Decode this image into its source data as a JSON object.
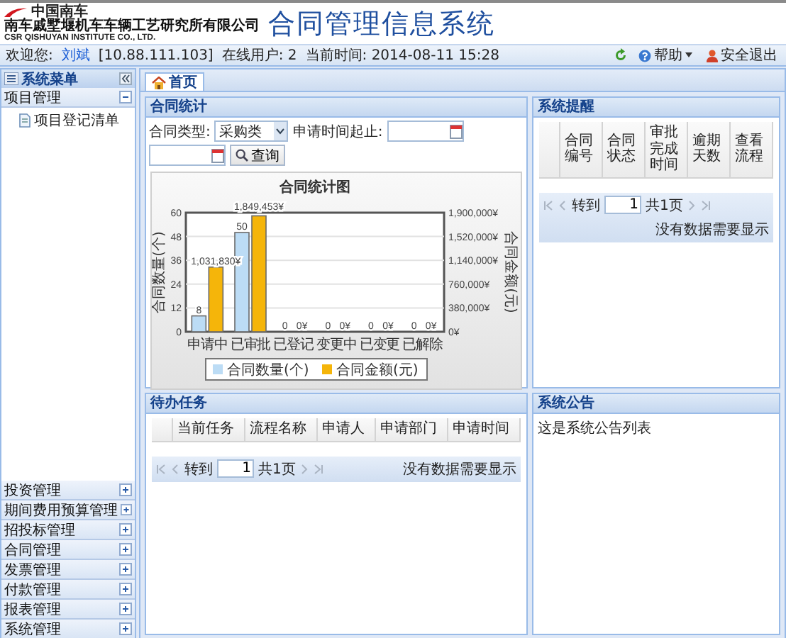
{
  "header": {
    "logo_text": "中国南车",
    "company": "南车戚墅堰机车车辆工艺研究所有限公司",
    "company_en": "CSR QISHUYAN INSTITUTE CO., LTD.",
    "system_title": "合同管理信息系统"
  },
  "status_bar": {
    "welcome_label": "欢迎您:",
    "user": "刘斌",
    "ip": "[10.88.111.103]",
    "online": "在线用户: 2",
    "time": "当前时间: 2014-08-11 15:28",
    "help": "帮助",
    "logout": "安全退出"
  },
  "sidebar": {
    "title": "系统菜单",
    "sections": [
      {
        "label": "项目管理",
        "expanded": true,
        "children": [
          {
            "label": "项目登记清单"
          }
        ]
      },
      {
        "label": "投资管理",
        "expanded": false
      },
      {
        "label": "期间费用预算管理",
        "expanded": false
      },
      {
        "label": "招投标管理",
        "expanded": false
      },
      {
        "label": "合同管理",
        "expanded": false
      },
      {
        "label": "发票管理",
        "expanded": false
      },
      {
        "label": "付款管理",
        "expanded": false
      },
      {
        "label": "报表管理",
        "expanded": false
      },
      {
        "label": "系统管理",
        "expanded": false
      }
    ]
  },
  "tabs": [
    {
      "label": "首页",
      "selected": true
    }
  ],
  "contract_stats": {
    "title": "合同统计",
    "type_label": "合同类型:",
    "type_value": "采购类",
    "date_label": "申请时间起止:",
    "query_button": "查询",
    "chart_data": {
      "type": "bar",
      "title": "合同统计图",
      "grid": true,
      "legend": "bottom",
      "categories": [
        "申请中",
        "已审批",
        "已登记",
        "变更中",
        "已变更",
        "已解除"
      ],
      "ylabel": "合同数量(个)",
      "ylim": [
        0,
        60
      ],
      "yticks": [
        0,
        12,
        24,
        36,
        48,
        60
      ],
      "y2label": "合同金额(元)",
      "y2lim": [
        0,
        1900000
      ],
      "y2ticks": [
        {
          "value": 0,
          "label": "0¥"
        },
        {
          "value": 380000,
          "label": "380,000¥"
        },
        {
          "value": 760000,
          "label": "760,000¥"
        },
        {
          "value": 1140000,
          "label": "1,140,000¥"
        },
        {
          "value": 1520000,
          "label": "1,520,000¥"
        },
        {
          "value": 1900000,
          "label": "1,900,000¥"
        }
      ],
      "series": [
        {
          "name": "合同数量(个)",
          "color": "#bcdcf5",
          "axis": "y",
          "values": [
            8,
            50,
            0,
            0,
            0,
            0
          ],
          "value_labels": [
            "8",
            "50",
            "0",
            "0",
            "0",
            "0"
          ]
        },
        {
          "name": "合同金额(元)",
          "color": "#f5b50a",
          "axis": "y2",
          "values": [
            1031830,
            1849453,
            0,
            0,
            0,
            0
          ],
          "value_labels": [
            "1,031,830¥",
            "1,849,453¥",
            "0¥",
            "0¥",
            "0¥",
            "0¥"
          ]
        }
      ]
    }
  },
  "reminders": {
    "title": "系统提醒",
    "columns": [
      "合同编号",
      "合同状态",
      "审批完成时间",
      "逾期天数",
      "查看流程"
    ],
    "pager": {
      "goto_label": "转到",
      "page": "1",
      "total": "共1页",
      "empty_message": "没有数据需要显示"
    }
  },
  "todo": {
    "title": "待办任务",
    "columns": [
      "当前任务",
      "流程名称",
      "申请人",
      "申请部门",
      "申请时间"
    ],
    "pager": {
      "goto_label": "转到",
      "page": "1",
      "total": "共1页",
      "empty_message": "没有数据需要显示"
    }
  },
  "notice": {
    "title": "系统公告",
    "text": "这是系统公告列表"
  }
}
